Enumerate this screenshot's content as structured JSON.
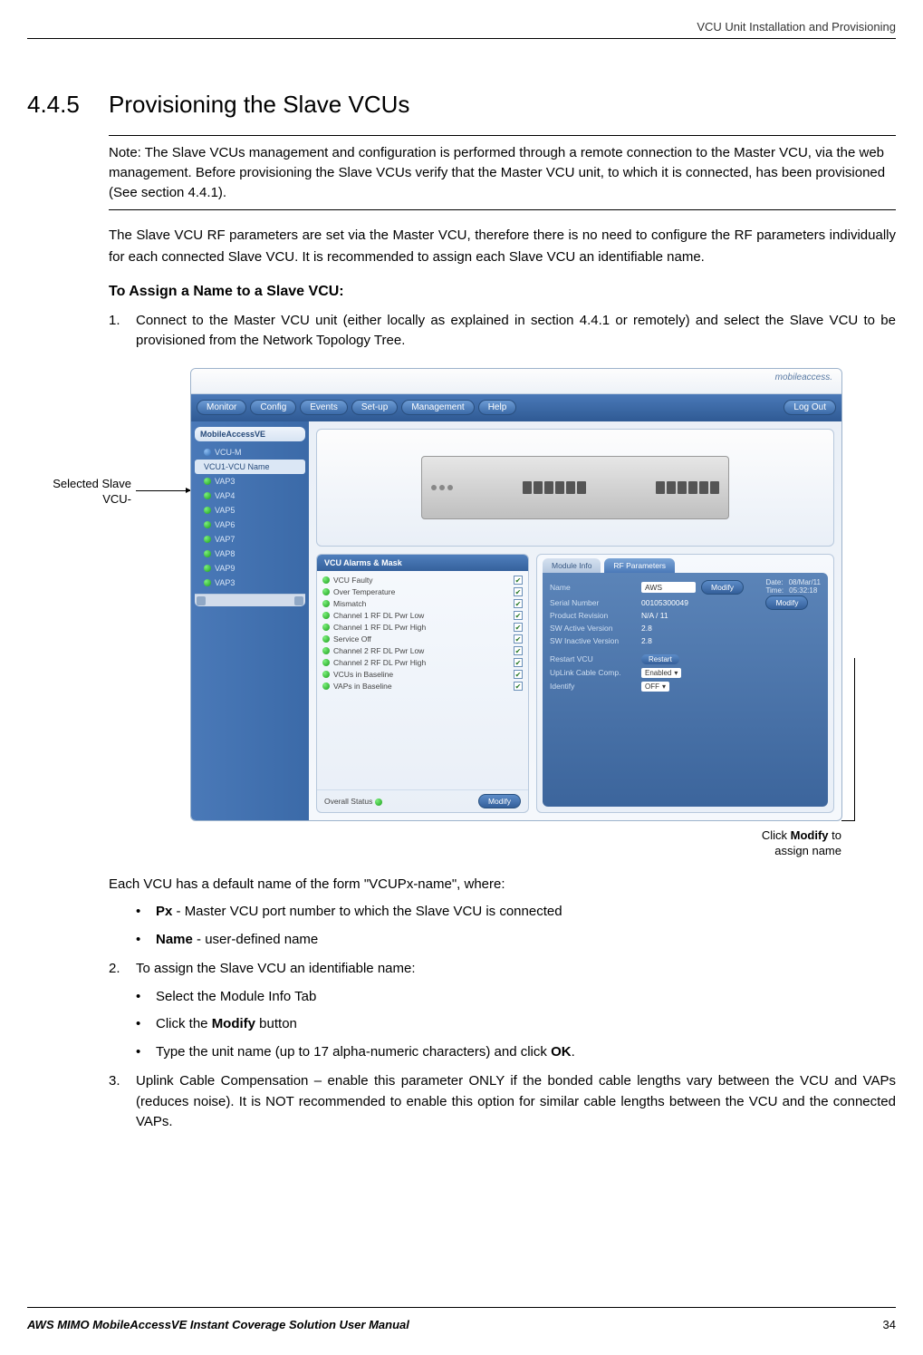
{
  "header": {
    "right": "VCU Unit Installation and Provisioning"
  },
  "section": {
    "number": "4.4.5",
    "title": "Provisioning the Slave VCUs",
    "note": "Note: The Slave VCUs management and configuration is performed through a remote connection to the Master VCU, via the web management. Before provisioning the Slave VCUs verify that the Master VCU unit, to which it is connected, has been provisioned (See section 4.4.1).",
    "para1": "The Slave VCU RF parameters are set via the Master VCU, therefore there is no need to configure the RF parameters individually for each connected Slave VCU. It is recommended to assign each Slave VCU an identifiable name.",
    "subheading": "To Assign a Name to a Slave VCU:",
    "step1": "Connect to the Master VCU unit (either locally as explained in section 4.4.1 or remotely) and select the Slave VCU to be provisioned from the Network Topology Tree.",
    "callout_left_l1": "Selected Slave",
    "callout_left_l2": "VCU-",
    "callout_right_l1": "Click ",
    "callout_right_bold": "Modify",
    "callout_right_l1b": " to",
    "callout_right_l2": "assign name",
    "after_fig": "Each VCU has a default name of the form \"VCUPx-name\", where:",
    "b1a": "Px",
    "b1b": " - Master VCU port number to which the Slave VCU is connected",
    "b2a": "Name",
    "b2b": " - user-defined name",
    "step2": "To assign the Slave VCU an identifiable name:",
    "b3": "Select the Module Info Tab",
    "b4a": "Click the ",
    "b4b": "Modify",
    "b4c": " button",
    "b5a": "Type the unit name (up to 17 alpha-numeric characters) and click ",
    "b5b": "OK",
    "b5c": ".",
    "step3": "Uplink Cable Compensation – enable this parameter ONLY if the bonded cable lengths vary between the VCU and VAPs (reduces noise). It is NOT recommended to enable this option for similar cable lengths between the VCU and the connected VAPs."
  },
  "screenshot": {
    "logo": "mobileaccess.",
    "nav": [
      "Monitor",
      "Config",
      "Events",
      "Set-up",
      "Management",
      "Help"
    ],
    "logout": "Log Out",
    "sidebar_title": "MobileAccessVE",
    "sidebar": [
      {
        "label": "VCU-M",
        "kind": "blue"
      },
      {
        "label": "VCU1-VCU Name",
        "kind": "selected"
      },
      {
        "label": "VAP3",
        "kind": "green"
      },
      {
        "label": "VAP4",
        "kind": "green"
      },
      {
        "label": "VAP5",
        "kind": "green"
      },
      {
        "label": "VAP6",
        "kind": "green"
      },
      {
        "label": "VAP7",
        "kind": "green"
      },
      {
        "label": "VAP8",
        "kind": "green"
      },
      {
        "label": "VAP9",
        "kind": "green"
      },
      {
        "label": "VAP3",
        "kind": "green"
      }
    ],
    "alarms_title": "VCU Alarms & Mask",
    "alarms": [
      "VCU Faulty",
      "Over Temperature",
      "Mismatch",
      "Channel 1 RF DL Pwr Low",
      "Channel 1 RF DL Pwr High",
      "Service Off",
      "Channel 2 RF DL Pwr Low",
      "Channel 2 RF DL Pwr High",
      "VCUs in Baseline",
      "VAPs in Baseline"
    ],
    "overall": "Overall Status",
    "modify": "Modify",
    "tab1": "Module Info",
    "tab2": "RF Parameters",
    "info": {
      "name_lab": "Name",
      "name_val": "AWS",
      "sn_lab": "Serial Number",
      "sn_val": "00105300049",
      "pr_lab": "Product Revision",
      "pr_val": "N/A / 11",
      "sa_lab": "SW Active Version",
      "sa_val": "2.8",
      "si_lab": "SW Inactive Version",
      "si_val": "2.8",
      "restart_lab": "Restart VCU",
      "restart_btn": "Restart",
      "ucc_lab": "UpLink Cable Comp.",
      "ucc_val": "Enabled",
      "id_lab": "Identify",
      "id_val": "OFF"
    },
    "date_lab": "Date:",
    "date_val": "08/Mar/11",
    "time_lab": "Time:",
    "time_val": "05:32:18"
  },
  "footer": {
    "left": "AWS MIMO MobileAccessVE Instant Coverage Solution User Manual",
    "right": "34"
  }
}
